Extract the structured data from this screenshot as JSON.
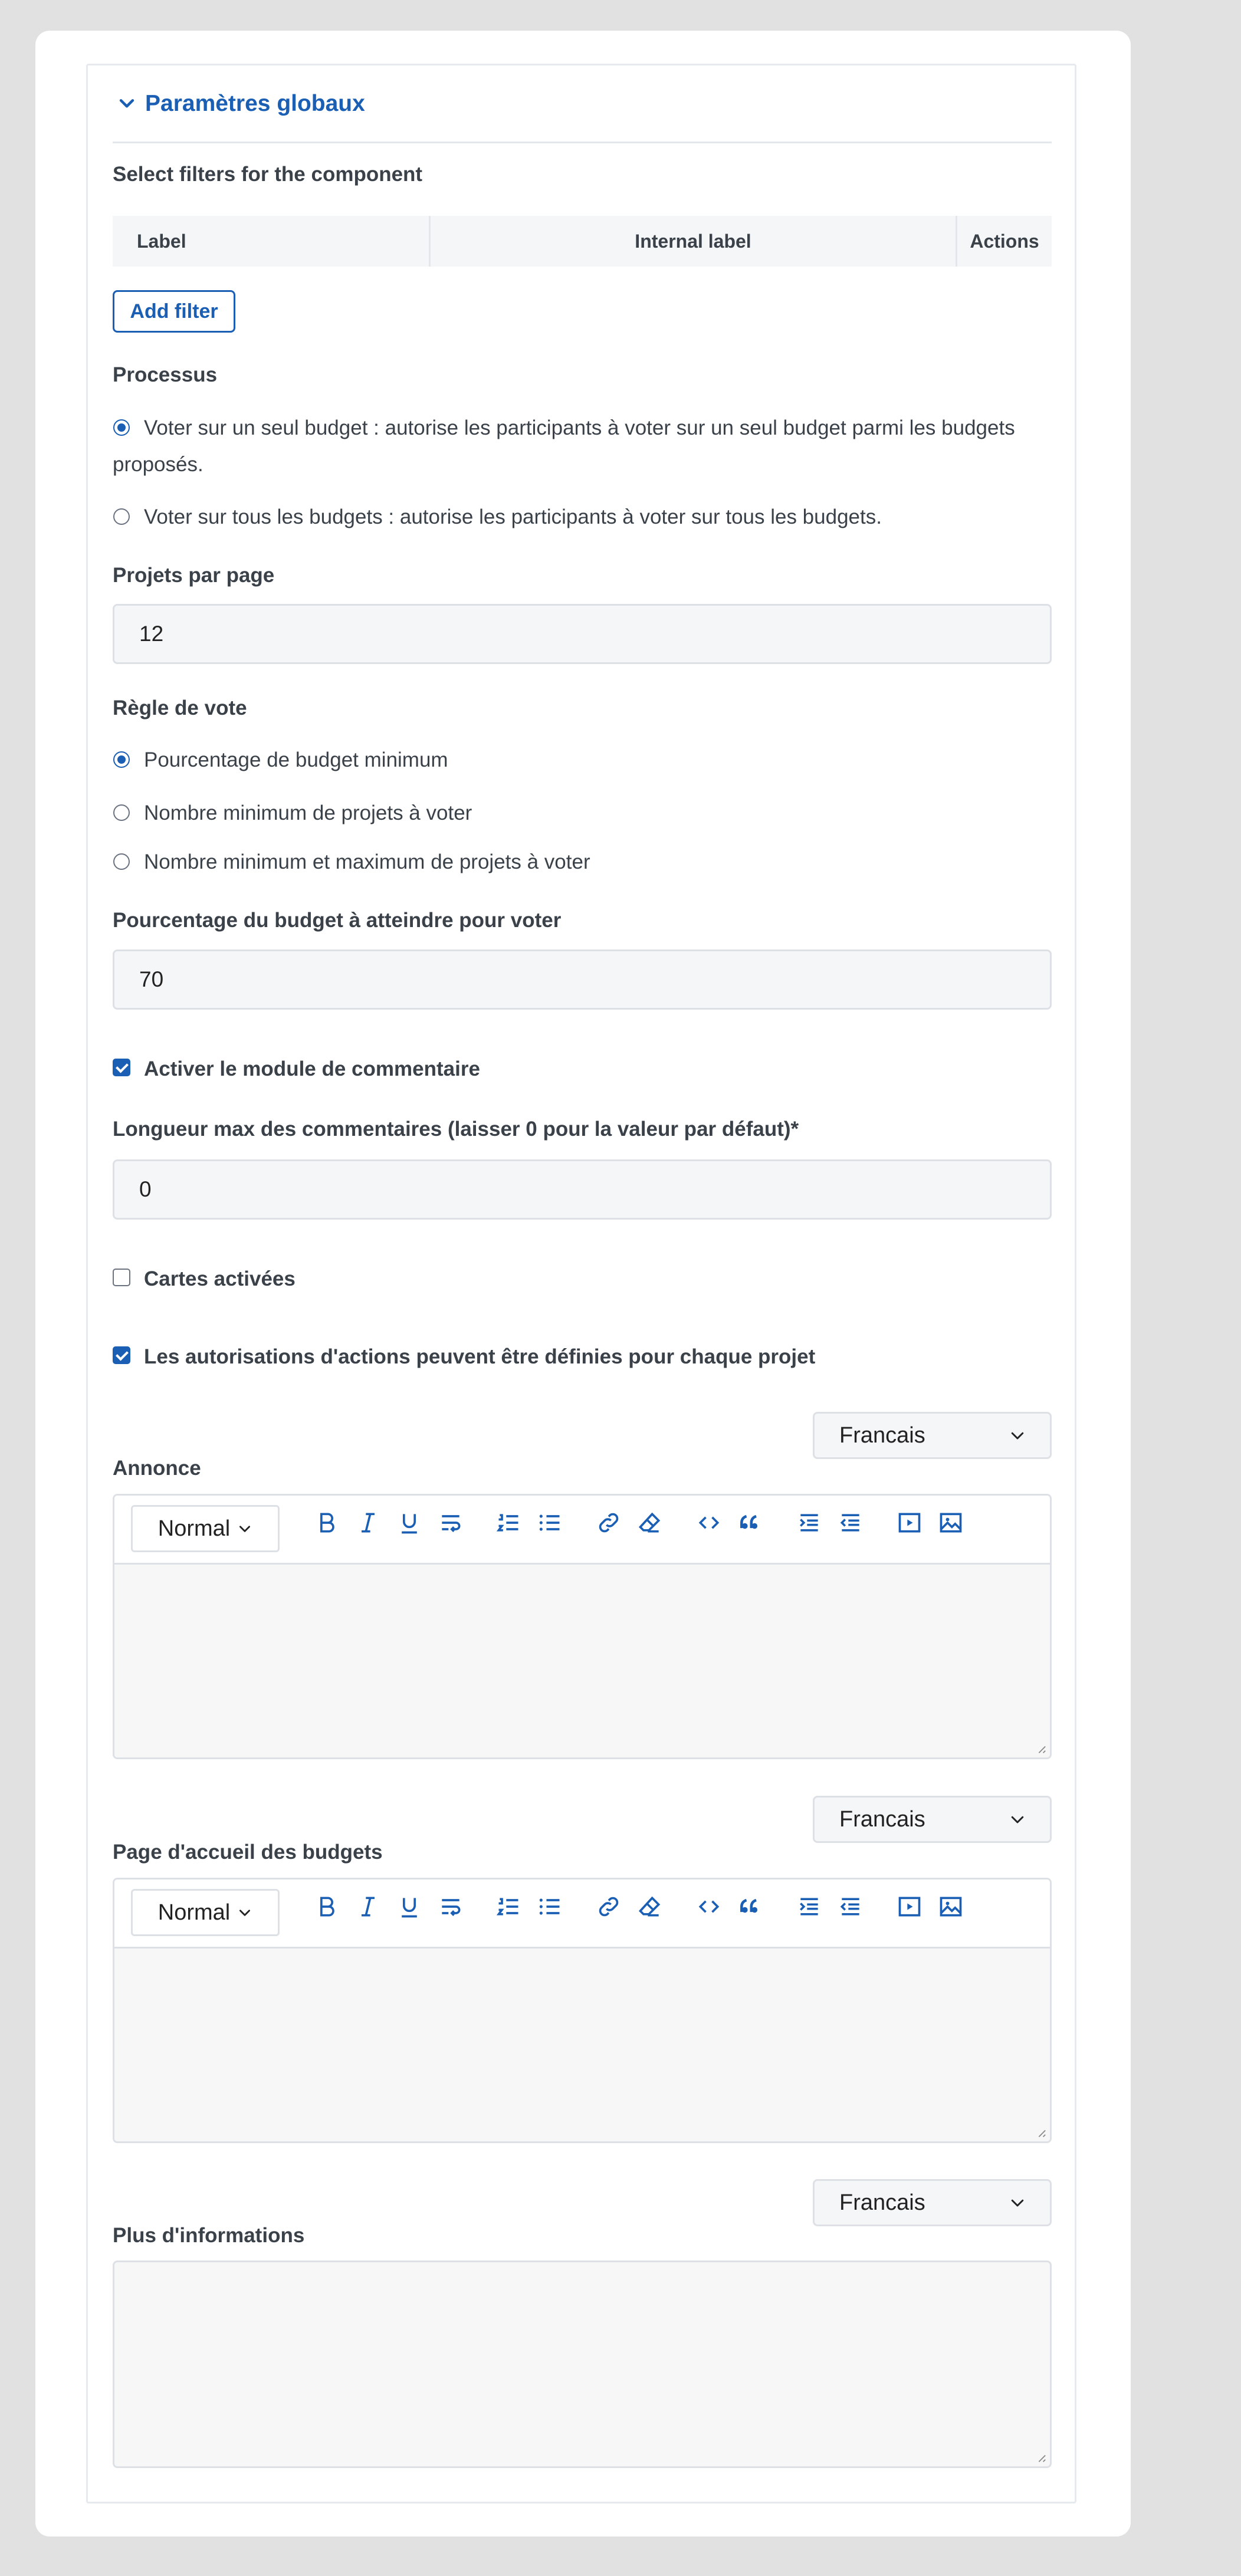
{
  "section": {
    "title": "Paramètres globaux",
    "icon": "chevron-down-icon"
  },
  "filters": {
    "label": "Select filters for the component",
    "columns": [
      "Label",
      "Internal label",
      "Actions"
    ],
    "add_button": "Add filter"
  },
  "processus": {
    "label": "Processus",
    "options": [
      {
        "line1": "Voter sur un seul budget : autorise les participants à voter sur un seul budget parmi les budgets",
        "line2": "proposés.",
        "checked": true
      },
      {
        "line1": "Voter sur tous les budgets : autorise les participants à voter sur tous les budgets.",
        "checked": false
      }
    ]
  },
  "projets_par_page": {
    "label": "Projets par page",
    "value": "12"
  },
  "regle_de_vote": {
    "label": "Règle de vote",
    "options": [
      {
        "text": "Pourcentage de budget minimum",
        "checked": true
      },
      {
        "text": "Nombre minimum de projets à voter",
        "checked": false
      },
      {
        "text": "Nombre minimum et maximum de projets à voter",
        "checked": false
      }
    ]
  },
  "pourcentage_budget": {
    "label": "Pourcentage du budget à atteindre pour voter",
    "value": "70"
  },
  "checkbox_comments": {
    "label": "Activer le module de commentaire",
    "checked": true
  },
  "longueur_max": {
    "label": "Longueur max des commentaires (laisser 0 pour la valeur par défaut)*",
    "value": "0"
  },
  "checkbox_cartes": {
    "label": "Cartes activées",
    "checked": false
  },
  "checkbox_autorisations": {
    "label": "Les autorisations d'actions peuvent être définies pour chaque projet",
    "checked": true
  },
  "annonce": {
    "label": "Annonce",
    "language": "Francais",
    "format": "Normal"
  },
  "page_accueil": {
    "label": "Page d'accueil des budgets",
    "language": "Francais",
    "format": "Normal"
  },
  "plus_infos": {
    "label": "Plus d'informations",
    "language": "Francais"
  },
  "accent_color": "#1a5fb4"
}
